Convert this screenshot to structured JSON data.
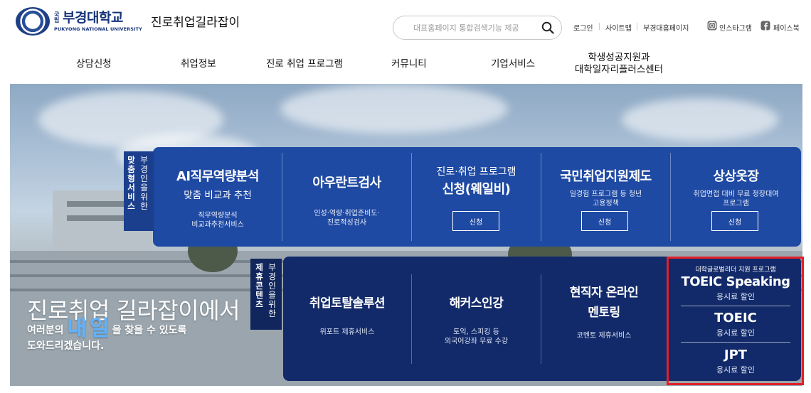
{
  "header": {
    "logo_gu": "국립",
    "logo_name": "부경대학교",
    "logo_en": "PUKYONG NATIONAL UNIVERSITY",
    "site_name": "진로취업길라잡이",
    "search_placeholder": "대표홈페이지 통합검색기능 제공",
    "util_links": [
      "로그인",
      "사이트맵",
      "부경대홈페이지"
    ],
    "social": {
      "instagram": "인스타그램",
      "facebook": "페이스북"
    }
  },
  "nav": {
    "items": [
      "상담신청",
      "취업정보",
      "진로 취업 프로그램",
      "커뮤니티",
      "기업서비스"
    ],
    "center_line1": "학생성공지원과",
    "center_line2": "대학일자리플러스센터"
  },
  "hero": {
    "title": "진로취업 길라잡이에서",
    "sub_pre": "여러분의",
    "sub_big": "내일",
    "sub_post": "을 찾을 수 있도록",
    "sub_line2": "도와드리겠습니다."
  },
  "panel1": {
    "tab_left": "맞춤형서비스",
    "tab_right": "부경인을위한",
    "items": [
      {
        "title": "AI직무역량분석",
        "sub": "맞춤 비교과 추천",
        "desc1": "직무역량분석",
        "desc2": "비교과추천서비스"
      },
      {
        "title": "아우란트검사",
        "desc1": "인성·역량·취업준비도·",
        "desc2": "진로적성검사"
      },
      {
        "title_top": "진로·취업 프로그램",
        "title": "신청(웨일비)",
        "button": "신청"
      },
      {
        "title": "국민취업지원제도",
        "desc1": "일경험 프로그램 등 청년",
        "desc2": "고용정책",
        "button": "신청"
      },
      {
        "title": "상상옷장",
        "desc1": "취업면접 대비 무료 정장대여",
        "desc2": "프로그램",
        "button": "신청"
      }
    ]
  },
  "panel2": {
    "tab_left": "제휴콘텐츠",
    "tab_right": "부경인을위한",
    "items": [
      {
        "title": "취업토탈솔루션",
        "desc1": "위포트 제휴서비스"
      },
      {
        "title": "해커스인강",
        "desc1": "토익, 스피킹 등",
        "desc2": "외국어강좌 무료 수강"
      },
      {
        "title1": "현직자 온라인",
        "title2": "멘토링",
        "desc1": "코멘토 제휴서비스"
      }
    ],
    "right_header": "대학글로벌리더 지원 프로그램",
    "right_items": [
      {
        "title": "TOEIC Speaking",
        "sub": "응시료 할인"
      },
      {
        "title": "TOEIC",
        "sub": "응시료 할인"
      },
      {
        "title": "JPT",
        "sub": "응시료 할인"
      }
    ]
  },
  "colors": {
    "panel1": "#1f4aa3",
    "panel2": "#122a69",
    "highlight": "#e0202a",
    "accent_text": "#5fb3ff"
  }
}
